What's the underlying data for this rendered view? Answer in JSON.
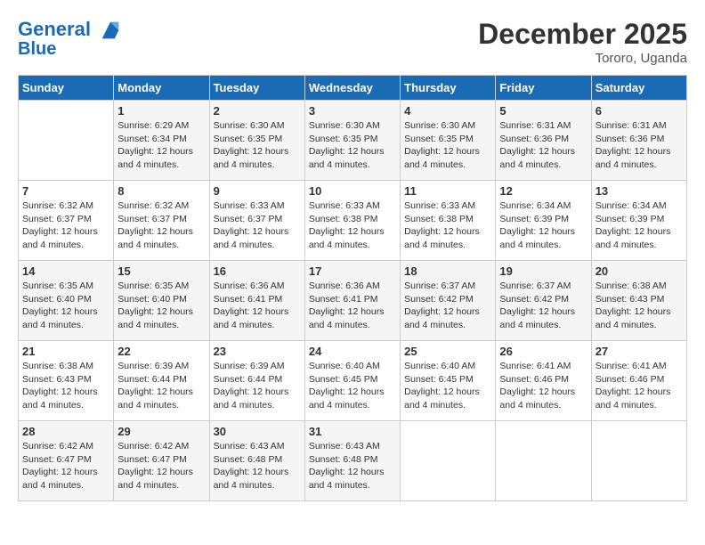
{
  "header": {
    "logo_line1": "General",
    "logo_line2": "Blue",
    "month": "December 2025",
    "location": "Tororo, Uganda"
  },
  "days_of_week": [
    "Sunday",
    "Monday",
    "Tuesday",
    "Wednesday",
    "Thursday",
    "Friday",
    "Saturday"
  ],
  "weeks": [
    [
      {
        "day": "",
        "info": ""
      },
      {
        "day": "1",
        "info": "Sunrise: 6:29 AM\nSunset: 6:34 PM\nDaylight: 12 hours and 4 minutes."
      },
      {
        "day": "2",
        "info": "Sunrise: 6:30 AM\nSunset: 6:35 PM\nDaylight: 12 hours and 4 minutes."
      },
      {
        "day": "3",
        "info": "Sunrise: 6:30 AM\nSunset: 6:35 PM\nDaylight: 12 hours and 4 minutes."
      },
      {
        "day": "4",
        "info": "Sunrise: 6:30 AM\nSunset: 6:35 PM\nDaylight: 12 hours and 4 minutes."
      },
      {
        "day": "5",
        "info": "Sunrise: 6:31 AM\nSunset: 6:36 PM\nDaylight: 12 hours and 4 minutes."
      },
      {
        "day": "6",
        "info": "Sunrise: 6:31 AM\nSunset: 6:36 PM\nDaylight: 12 hours and 4 minutes."
      }
    ],
    [
      {
        "day": "7",
        "info": "Sunrise: 6:32 AM\nSunset: 6:37 PM\nDaylight: 12 hours and 4 minutes."
      },
      {
        "day": "8",
        "info": "Sunrise: 6:32 AM\nSunset: 6:37 PM\nDaylight: 12 hours and 4 minutes."
      },
      {
        "day": "9",
        "info": "Sunrise: 6:33 AM\nSunset: 6:37 PM\nDaylight: 12 hours and 4 minutes."
      },
      {
        "day": "10",
        "info": "Sunrise: 6:33 AM\nSunset: 6:38 PM\nDaylight: 12 hours and 4 minutes."
      },
      {
        "day": "11",
        "info": "Sunrise: 6:33 AM\nSunset: 6:38 PM\nDaylight: 12 hours and 4 minutes."
      },
      {
        "day": "12",
        "info": "Sunrise: 6:34 AM\nSunset: 6:39 PM\nDaylight: 12 hours and 4 minutes."
      },
      {
        "day": "13",
        "info": "Sunrise: 6:34 AM\nSunset: 6:39 PM\nDaylight: 12 hours and 4 minutes."
      }
    ],
    [
      {
        "day": "14",
        "info": "Sunrise: 6:35 AM\nSunset: 6:40 PM\nDaylight: 12 hours and 4 minutes."
      },
      {
        "day": "15",
        "info": "Sunrise: 6:35 AM\nSunset: 6:40 PM\nDaylight: 12 hours and 4 minutes."
      },
      {
        "day": "16",
        "info": "Sunrise: 6:36 AM\nSunset: 6:41 PM\nDaylight: 12 hours and 4 minutes."
      },
      {
        "day": "17",
        "info": "Sunrise: 6:36 AM\nSunset: 6:41 PM\nDaylight: 12 hours and 4 minutes."
      },
      {
        "day": "18",
        "info": "Sunrise: 6:37 AM\nSunset: 6:42 PM\nDaylight: 12 hours and 4 minutes."
      },
      {
        "day": "19",
        "info": "Sunrise: 6:37 AM\nSunset: 6:42 PM\nDaylight: 12 hours and 4 minutes."
      },
      {
        "day": "20",
        "info": "Sunrise: 6:38 AM\nSunset: 6:43 PM\nDaylight: 12 hours and 4 minutes."
      }
    ],
    [
      {
        "day": "21",
        "info": "Sunrise: 6:38 AM\nSunset: 6:43 PM\nDaylight: 12 hours and 4 minutes."
      },
      {
        "day": "22",
        "info": "Sunrise: 6:39 AM\nSunset: 6:44 PM\nDaylight: 12 hours and 4 minutes."
      },
      {
        "day": "23",
        "info": "Sunrise: 6:39 AM\nSunset: 6:44 PM\nDaylight: 12 hours and 4 minutes."
      },
      {
        "day": "24",
        "info": "Sunrise: 6:40 AM\nSunset: 6:45 PM\nDaylight: 12 hours and 4 minutes."
      },
      {
        "day": "25",
        "info": "Sunrise: 6:40 AM\nSunset: 6:45 PM\nDaylight: 12 hours and 4 minutes."
      },
      {
        "day": "26",
        "info": "Sunrise: 6:41 AM\nSunset: 6:46 PM\nDaylight: 12 hours and 4 minutes."
      },
      {
        "day": "27",
        "info": "Sunrise: 6:41 AM\nSunset: 6:46 PM\nDaylight: 12 hours and 4 minutes."
      }
    ],
    [
      {
        "day": "28",
        "info": "Sunrise: 6:42 AM\nSunset: 6:47 PM\nDaylight: 12 hours and 4 minutes."
      },
      {
        "day": "29",
        "info": "Sunrise: 6:42 AM\nSunset: 6:47 PM\nDaylight: 12 hours and 4 minutes."
      },
      {
        "day": "30",
        "info": "Sunrise: 6:43 AM\nSunset: 6:48 PM\nDaylight: 12 hours and 4 minutes."
      },
      {
        "day": "31",
        "info": "Sunrise: 6:43 AM\nSunset: 6:48 PM\nDaylight: 12 hours and 4 minutes."
      },
      {
        "day": "",
        "info": ""
      },
      {
        "day": "",
        "info": ""
      },
      {
        "day": "",
        "info": ""
      }
    ]
  ]
}
